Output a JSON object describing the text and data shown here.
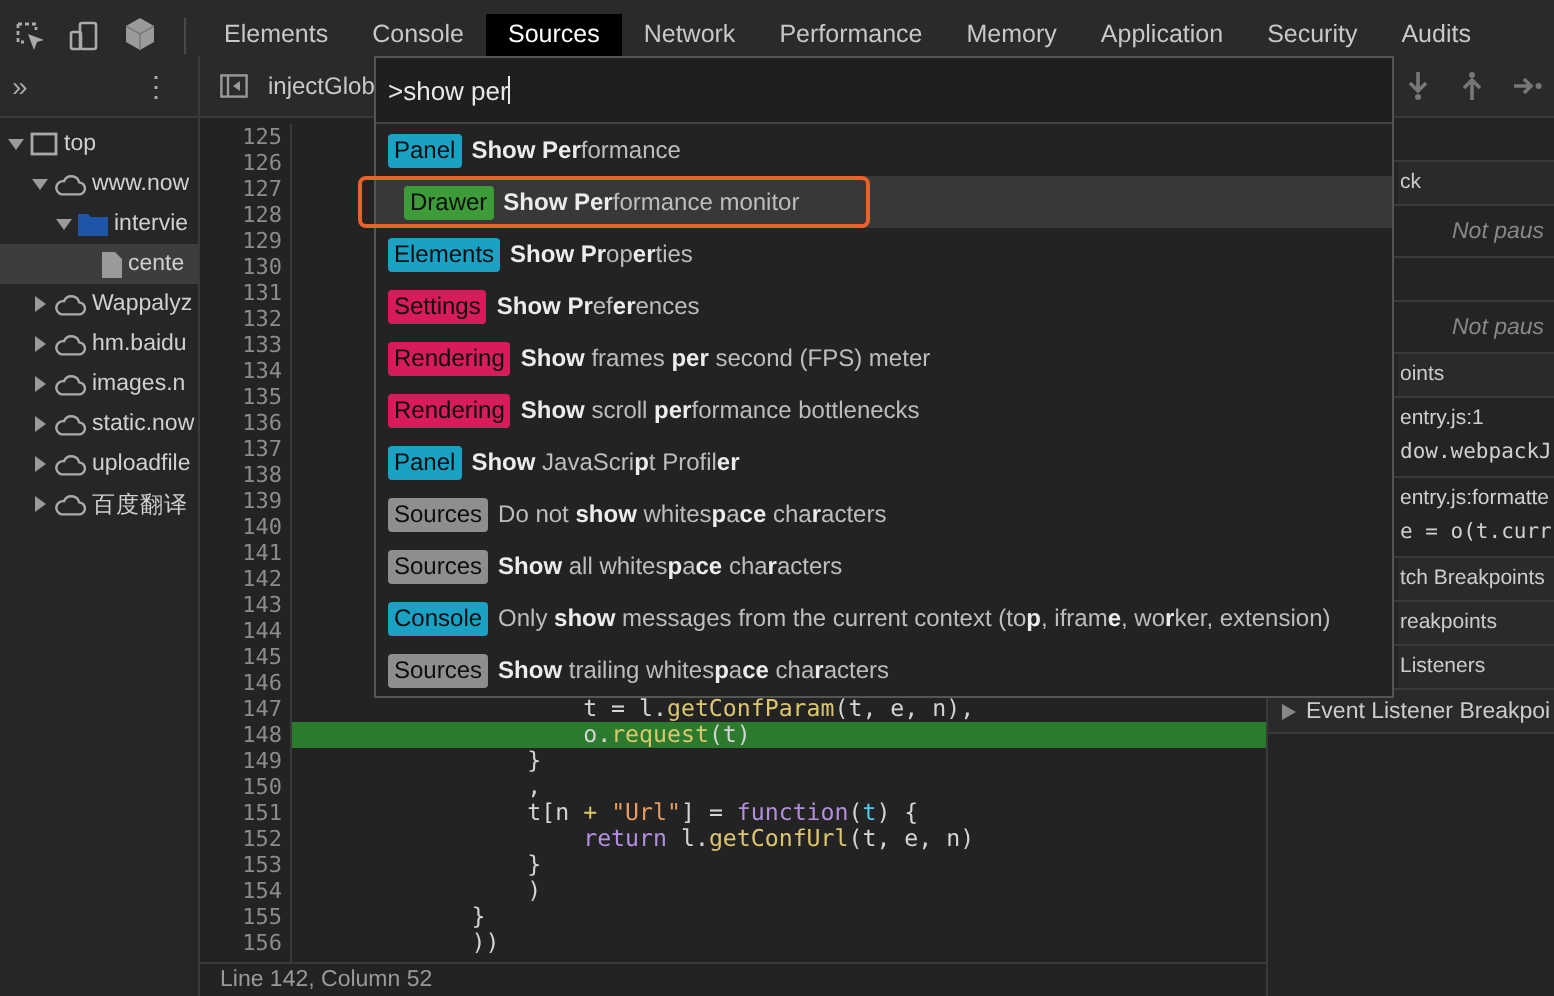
{
  "toolbar": {
    "tabs": [
      {
        "label": "Elements",
        "selected": false
      },
      {
        "label": "Console",
        "selected": false
      },
      {
        "label": "Sources",
        "selected": true
      },
      {
        "label": "Network",
        "selected": false
      },
      {
        "label": "Performance",
        "selected": false
      },
      {
        "label": "Memory",
        "selected": false
      },
      {
        "label": "Application",
        "selected": false
      },
      {
        "label": "Security",
        "selected": false
      },
      {
        "label": "Audits",
        "selected": false
      }
    ]
  },
  "navigator": {
    "more": "»",
    "menu": "⋮"
  },
  "sidebar": {
    "tree": [
      {
        "label": "top",
        "kind": "frame",
        "expanded": true,
        "selected": false,
        "children": [
          {
            "label": "www.now",
            "kind": "cloud",
            "expanded": true,
            "selected": false,
            "children": [
              {
                "label": "intervie",
                "kind": "folder",
                "expanded": true,
                "selected": false,
                "children": [
                  {
                    "label": "cente",
                    "kind": "file",
                    "selected": true
                  }
                ]
              }
            ]
          },
          {
            "label": "Wappalyz",
            "kind": "cloud",
            "expanded": false,
            "selected": false
          },
          {
            "label": "hm.baidu",
            "kind": "cloud",
            "expanded": false,
            "selected": false
          },
          {
            "label": "images.n",
            "kind": "cloud",
            "expanded": false,
            "selected": false
          },
          {
            "label": "static.now",
            "kind": "cloud",
            "expanded": false,
            "selected": false
          },
          {
            "label": "uploadfile",
            "kind": "cloud",
            "expanded": false,
            "selected": false
          },
          {
            "label": "百度翻译",
            "kind": "cloud",
            "expanded": false,
            "selected": false
          }
        ]
      }
    ]
  },
  "editor": {
    "file_tab": "injectGlob",
    "lines": [
      {
        "number": "125"
      },
      {
        "number": "126"
      },
      {
        "number": "127"
      },
      {
        "number": "128"
      },
      {
        "number": "129"
      },
      {
        "number": "130"
      },
      {
        "number": "131"
      },
      {
        "number": "132"
      },
      {
        "number": "133"
      },
      {
        "number": "134"
      },
      {
        "number": "135"
      },
      {
        "number": "136"
      },
      {
        "number": "137"
      },
      {
        "number": "138"
      },
      {
        "number": "139"
      },
      {
        "number": "140"
      },
      {
        "number": "141"
      },
      {
        "number": "142"
      },
      {
        "number": "143"
      },
      {
        "number": "144"
      },
      {
        "number": "145"
      },
      {
        "number": "146"
      },
      {
        "number": "147",
        "highlighted": false,
        "tokens": [
          {
            "text": "                    t = l.",
            "kind": "plain"
          },
          {
            "text": "getConfParam",
            "kind": "function"
          },
          {
            "text": "(t, e, n),",
            "kind": "plain"
          }
        ]
      },
      {
        "number": "148",
        "highlighted": true,
        "tokens": [
          {
            "text": "                    o.",
            "kind": "plain"
          },
          {
            "text": "request",
            "kind": "function"
          },
          {
            "text": "(t)",
            "kind": "plain"
          }
        ]
      },
      {
        "number": "149",
        "highlighted": false,
        "tokens": [
          {
            "text": "                }",
            "kind": "plain"
          }
        ]
      },
      {
        "number": "150",
        "highlighted": false,
        "tokens": [
          {
            "text": "                ,",
            "kind": "plain"
          }
        ]
      },
      {
        "number": "151",
        "highlighted": false,
        "tokens": [
          {
            "text": "                t[n ",
            "kind": "plain"
          },
          {
            "text": "+",
            "kind": "operator"
          },
          {
            "text": " \"Url\"",
            "kind": "string"
          },
          {
            "text": "] = ",
            "kind": "plain"
          },
          {
            "text": "function",
            "kind": "keyword"
          },
          {
            "text": "(",
            "kind": "plain"
          },
          {
            "text": "t",
            "kind": "param"
          },
          {
            "text": ") {",
            "kind": "plain"
          }
        ]
      },
      {
        "number": "152",
        "highlighted": false,
        "tokens": [
          {
            "text": "                    return",
            "kind": "keyword"
          },
          {
            "text": " l.",
            "kind": "plain"
          },
          {
            "text": "getConfUrl",
            "kind": "function"
          },
          {
            "text": "(t, e, n)",
            "kind": "plain"
          }
        ]
      },
      {
        "number": "153",
        "highlighted": false,
        "tokens": [
          {
            "text": "                }",
            "kind": "plain"
          }
        ]
      },
      {
        "number": "154",
        "highlighted": false,
        "tokens": [
          {
            "text": "                )",
            "kind": "plain"
          }
        ]
      },
      {
        "number": "155",
        "highlighted": false,
        "tokens": [
          {
            "text": "            }",
            "kind": "plain"
          }
        ]
      },
      {
        "number": "156",
        "highlighted": false,
        "tokens": [
          {
            "text": "            ))",
            "kind": "plain"
          }
        ]
      }
    ],
    "status_bar": "Line 142, Column 52"
  },
  "palette": {
    "query": ">show per",
    "items": [
      {
        "category": "Panel",
        "color": "#1ba1c4",
        "text": "**Show Per**formance",
        "selected": false
      },
      {
        "category": "Drawer",
        "color": "#3e9b3a",
        "text": "**Show Per**formance monitor",
        "selected": true
      },
      {
        "category": "Elements",
        "color": "#1ba1c4",
        "text": "**Show Pr**op**er**ties",
        "selected": false
      },
      {
        "category": "Settings",
        "color": "#d81b5c",
        "text": "**Show Pr**ef**er**ences",
        "selected": false
      },
      {
        "category": "Rendering",
        "color": "#d81b5c",
        "text": "**Show** frames **per** second (FPS) meter",
        "selected": false
      },
      {
        "category": "Rendering",
        "color": "#d81b5c",
        "text": "**Show** scroll **per**formance bottlenecks",
        "selected": false
      },
      {
        "category": "Panel",
        "color": "#1ba1c4",
        "text": "**Show** JavaScri**p**t Profil**er**",
        "selected": false
      },
      {
        "category": "Sources",
        "color": "#8e8e8e",
        "text": "Do not **show** whites**p**a**ce** cha**r**acters",
        "selected": false
      },
      {
        "category": "Sources",
        "color": "#8e8e8e",
        "text": "**Show** all whites**p**a**ce** cha**r**acters",
        "selected": false
      },
      {
        "category": "Console",
        "color": "#1ba1c4",
        "text": "Only **show** messages from the current context (to**p**, ifram**e**, wo**r**ker, extension)",
        "selected": false
      },
      {
        "category": "Sources",
        "color": "#8e8e8e",
        "text": "**Show** trailing whites**p**a**ce** cha**r**acters",
        "selected": false
      }
    ]
  },
  "right_panel": {
    "rows": [
      {
        "kind": "blank"
      },
      {
        "kind": "header",
        "text": "ck"
      },
      {
        "kind": "note",
        "text": "Not paus"
      },
      {
        "kind": "blank"
      },
      {
        "kind": "note",
        "text": "Not paus"
      },
      {
        "kind": "header",
        "text": "oints"
      },
      {
        "kind": "file",
        "text": "entry.js:1"
      },
      {
        "kind": "code",
        "text": "dow.webpackJ"
      },
      {
        "kind": "file",
        "text": "entry.js:formatte"
      },
      {
        "kind": "code",
        "text": "e = o(t.curr"
      },
      {
        "kind": "header",
        "text": "tch Breakpoints"
      },
      {
        "kind": "header",
        "text": "reakpoints"
      },
      {
        "kind": "header",
        "text": "Listeners"
      },
      {
        "kind": "section",
        "text": "Event Listener Breakpoi"
      }
    ]
  }
}
